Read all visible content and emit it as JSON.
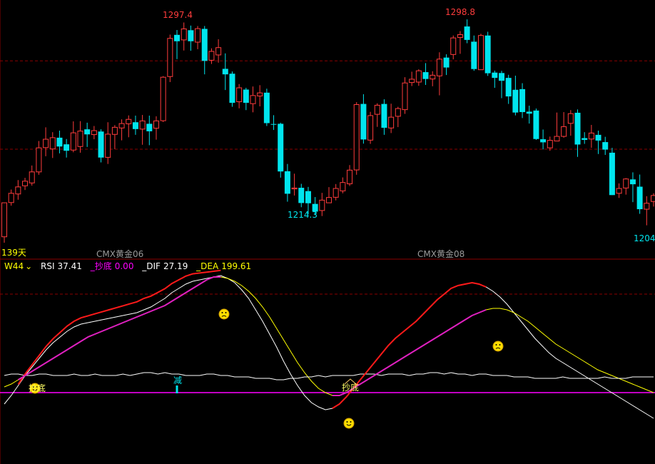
{
  "colors": {
    "up": "#ff3c3c",
    "down": "#00e5ee",
    "grid": "#8b0000",
    "label_yellow": "#ffff00",
    "rsi": "#ffffff",
    "dip": "#ff00ff",
    "dif": "#ffffff",
    "dea": "#ffff00",
    "macd_up": "#ff1a1a",
    "macd_mid": "#e020c0",
    "contract_label": "#9a9a9a"
  },
  "price_panel": {
    "high_label_1": "1297.4",
    "high_label_2": "1298.8",
    "low_label_1": "1214.3",
    "low_label_2": "1204.",
    "days_label": "139天",
    "contract_1": "CMX黄金06",
    "contract_2": "CMX黄金08"
  },
  "indicator_bar": {
    "period": "W44",
    "rsi_label": "RSI",
    "rsi_value": "37.41",
    "dip_label": "_抄底",
    "dip_value": "0.00",
    "dif_label": "_DIF",
    "dif_value": "27.19",
    "dea_label": "_DEA",
    "dea_value": "199.61"
  },
  "indicator_panel": {
    "marker_text_1": "抄底",
    "marker_text_2": "抄底",
    "marker_text_3": "减",
    "smiley_happy": "smiley-happy-icon",
    "smiley_sad": "smiley-sad-icon"
  },
  "chart_data": [
    {
      "type": "candlestick",
      "title": "",
      "y_range": [
        1196,
        1305
      ],
      "reference_lines": [
        1280,
        1240
      ],
      "candles": [
        [
          1200.3,
          1215.7,
          1197.6,
          1215.8
        ],
        [
          1215.8,
          1220.0,
          1214.4,
          1221.7
        ],
        [
          1219.7,
          1222.9,
          1217.1,
          1226.0
        ],
        [
          1223.4,
          1225.5,
          1221.5,
          1227.0
        ],
        [
          1224.7,
          1229.7,
          1223.5,
          1232.6
        ],
        [
          1229.7,
          1240.6,
          1228.4,
          1243.7
        ],
        [
          1240.7,
          1244.5,
          1236.8,
          1249.9
        ],
        [
          1240.1,
          1245.2,
          1236.0,
          1247.7
        ],
        [
          1245.2,
          1241.2,
          1238.1,
          1248.4
        ],
        [
          1242.2,
          1239.3,
          1236.2,
          1244.6
        ],
        [
          1239.6,
          1247.4,
          1238.6,
          1252.6
        ],
        [
          1241.2,
          1248.2,
          1238.4,
          1252.7
        ],
        [
          1249.0,
          1246.7,
          1241.0,
          1252.0
        ],
        [
          1246.6,
          1248.4,
          1244.5,
          1250.5
        ],
        [
          1248.0,
          1236.2,
          1234.0,
          1249.0
        ],
        [
          1236.3,
          1246.8,
          1233.3,
          1252.2
        ],
        [
          1246.7,
          1249.9,
          1240.0,
          1250.9
        ],
        [
          1249.6,
          1251.6,
          1244.0,
          1253.5
        ],
        [
          1251.5,
          1253.5,
          1245.4,
          1255.3
        ],
        [
          1252.2,
          1249.1,
          1246.5,
          1255.2
        ],
        [
          1249.1,
          1252.8,
          1242.0,
          1255.5
        ],
        [
          1251.5,
          1248.1,
          1241.8,
          1255.2
        ],
        [
          1249.5,
          1252.8,
          1244.3,
          1254.9
        ],
        [
          1252.9,
          1272.6,
          1252.3,
          1273.1
        ],
        [
          1272.9,
          1290.2,
          1270.4,
          1291.9
        ],
        [
          1291.8,
          1288.9,
          1280.8,
          1294.0
        ],
        [
          1289.5,
          1294.5,
          1284.7,
          1297.4
        ],
        [
          1293.9,
          1288.9,
          1284.6,
          1296.0
        ],
        [
          1288.5,
          1294.6,
          1285.3,
          1295.8
        ],
        [
          1294.5,
          1280.0,
          1273.9,
          1295.8
        ],
        [
          1280.3,
          1284.3,
          1278.6,
          1285.7
        ],
        [
          1282.7,
          1286.0,
          1279.2,
          1289.8
        ],
        [
          1276.4,
          1273.9,
          1266.8,
          1283.4
        ],
        [
          1274.2,
          1261.0,
          1259.2,
          1275.2
        ],
        [
          1261.5,
          1267.8,
          1258.5,
          1269.5
        ],
        [
          1267.0,
          1261.0,
          1257.7,
          1267.8
        ],
        [
          1260.6,
          1264.3,
          1256.7,
          1268.4
        ],
        [
          1264.1,
          1265.5,
          1259.4,
          1269.0
        ],
        [
          1265.6,
          1251.8,
          1250.5,
          1267.4
        ],
        [
          1251.4,
          1251.1,
          1248.7,
          1255.4
        ],
        [
          1251.5,
          1229.9,
          1227.1,
          1252.0
        ],
        [
          1230.0,
          1219.8,
          1216.2,
          1233.3
        ],
        [
          1222.0,
          1222.4,
          1219.0,
          1228.9
        ],
        [
          1222.5,
          1215.6,
          1213.7,
          1224.3
        ],
        [
          1221.0,
          1215.5,
          1210.4,
          1222.9
        ],
        [
          1215.2,
          1211.7,
          1210.1,
          1218.3
        ],
        [
          1212.2,
          1216.9,
          1209.7,
          1220.2
        ],
        [
          1215.7,
          1218.1,
          1215.6,
          1222.8
        ],
        [
          1218.2,
          1222.2,
          1216.8,
          1224.2
        ],
        [
          1221.1,
          1224.9,
          1220.0,
          1227.2
        ],
        [
          1224.3,
          1230.5,
          1223.3,
          1232.8
        ],
        [
          1230.6,
          1260.2,
          1228.4,
          1261.3
        ],
        [
          1260.5,
          1244.4,
          1242.5,
          1264.9
        ],
        [
          1244.1,
          1255.2,
          1242.4,
          1256.9
        ],
        [
          1255.8,
          1259.9,
          1250.1,
          1260.8
        ],
        [
          1260.5,
          1249.7,
          1246.5,
          1262.6
        ],
        [
          1249.6,
          1254.5,
          1247.3,
          1260.6
        ],
        [
          1254.9,
          1258.4,
          1250.0,
          1259.2
        ],
        [
          1257.9,
          1270.0,
          1256.0,
          1272.6
        ],
        [
          1270.2,
          1271.7,
          1268.6,
          1275.1
        ],
        [
          1270.4,
          1275.5,
          1268.7,
          1276.2
        ],
        [
          1274.9,
          1271.8,
          1269.1,
          1279.0
        ],
        [
          1271.8,
          1273.5,
          1268.5,
          1275.3
        ],
        [
          1273.2,
          1280.8,
          1264.4,
          1283.9
        ],
        [
          1281.5,
          1277.0,
          1273.6,
          1283.0
        ],
        [
          1282.9,
          1290.4,
          1280.7,
          1291.5
        ],
        [
          1290.6,
          1291.9,
          1283.2,
          1293.5
        ],
        [
          1295.6,
          1289.5,
          1288.0,
          1298.8
        ],
        [
          1288.7,
          1276.3,
          1275.5,
          1291.5
        ],
        [
          1276.0,
          1291.5,
          1275.9,
          1292.3
        ],
        [
          1291.5,
          1274.4,
          1273.2,
          1293.2
        ],
        [
          1274.7,
          1272.3,
          1267.8,
          1275.6
        ],
        [
          1274.5,
          1271.0,
          1263.1,
          1275.5
        ],
        [
          1272.3,
          1263.9,
          1260.5,
          1273.7
        ],
        [
          1266.9,
          1256.6,
          1255.3,
          1273.3
        ],
        [
          1267.2,
          1256.8,
          1254.1,
          1269.9
        ],
        [
          1257.0,
          1256.1,
          1251.6,
          1259.7
        ],
        [
          1257.5,
          1244.6,
          1244.2,
          1258.4
        ],
        [
          1244.5,
          1243.1,
          1239.9,
          1248.9
        ],
        [
          1240.6,
          1244.0,
          1239.3,
          1245.7
        ],
        [
          1243.7,
          1245.8,
          1244.0,
          1256.6
        ],
        [
          1245.8,
          1250.2,
          1245.2,
          1256.8
        ],
        [
          1251.7,
          1256.1,
          1246.1,
          1257.7
        ],
        [
          1256.5,
          1242.1,
          1236.5,
          1258.0
        ],
        [
          1245.0,
          1244.2,
          1242.4,
          1247.7
        ],
        [
          1244.6,
          1247.3,
          1240.6,
          1251.0
        ],
        [
          1246.5,
          1243.9,
          1237.8,
          1248.4
        ],
        [
          1243.2,
          1239.8,
          1237.4,
          1245.6
        ],
        [
          1238.4,
          1219.2,
          1219.2,
          1240.6
        ],
        [
          1220.0,
          1222.2,
          1217.9,
          1224.5
        ],
        [
          1222.4,
          1226.5,
          1219.4,
          1226.9
        ],
        [
          1226.3,
          1224.1,
          1216.0,
          1229.5
        ],
        [
          1223.0,
          1212.8,
          1210.7,
          1228.5
        ],
        [
          1212.8,
          1215.5,
          1205.5,
          1218.7
        ],
        [
          1216.3,
          1219.0,
          1214.0,
          1220.0
        ]
      ]
    },
    {
      "type": "line",
      "title": "",
      "y_range": [
        0,
        100
      ],
      "series": [
        {
          "name": "DIF",
          "line": [
            32,
            38,
            45,
            52,
            58,
            64,
            70,
            75,
            79,
            83,
            86,
            88,
            89,
            90,
            91,
            92,
            93,
            94,
            95,
            96,
            98,
            100,
            103,
            106,
            110,
            113,
            116,
            118,
            119,
            120,
            121,
            122,
            120,
            117,
            112,
            106,
            98,
            90,
            81,
            72,
            62,
            53,
            45,
            38,
            33,
            30,
            28,
            29,
            32,
            37,
            43,
            49,
            55,
            61,
            67,
            73,
            78,
            82,
            86,
            90,
            95,
            100,
            105,
            109,
            113,
            115,
            116,
            117,
            116,
            114,
            111,
            107,
            102,
            96,
            90,
            84,
            78,
            73,
            68,
            64,
            61,
            58,
            55,
            52,
            49,
            46,
            43,
            40,
            37,
            34,
            31,
            28,
            25,
            22
          ]
        },
        {
          "name": "DEA",
          "line": [
            44,
            46,
            49,
            52,
            55,
            58,
            61,
            64,
            67,
            70,
            73,
            76,
            79,
            81,
            83,
            85,
            87,
            89,
            91,
            93,
            95,
            97,
            99,
            101,
            104,
            107,
            110,
            113,
            116,
            119,
            121,
            121,
            120,
            118,
            115,
            111,
            106,
            100,
            93,
            85,
            77,
            69,
            61,
            54,
            48,
            43,
            40,
            38,
            38,
            40,
            43,
            46,
            49,
            52,
            55,
            58,
            61,
            64,
            67,
            70,
            73,
            76,
            79,
            82,
            85,
            88,
            91,
            94,
            96,
            98,
            99,
            99,
            98,
            96,
            93,
            90,
            86,
            82,
            78,
            74,
            71,
            68,
            65,
            62,
            59,
            56,
            54,
            52,
            50,
            48,
            46,
            44,
            42,
            40
          ]
        },
        {
          "name": "RSI",
          "line": [
            52,
            53,
            53,
            52,
            52,
            53,
            53,
            52,
            52,
            52,
            53,
            52,
            52,
            53,
            52,
            52,
            52,
            53,
            52,
            53,
            54,
            54,
            53,
            54,
            53,
            53,
            52,
            52,
            52,
            53,
            53,
            52,
            52,
            51,
            51,
            51,
            50,
            50,
            50,
            49,
            49,
            50,
            50,
            51,
            51,
            52,
            51,
            52,
            52,
            52,
            52,
            53,
            53,
            53,
            52,
            53,
            53,
            53,
            52,
            53,
            53,
            54,
            54,
            53,
            54,
            53,
            53,
            52,
            53,
            53,
            52,
            52,
            52,
            51,
            51,
            51,
            50,
            50,
            50,
            50,
            51,
            50,
            50,
            50,
            50,
            50,
            51,
            50,
            50,
            50,
            51,
            51,
            51,
            51
          ]
        }
      ]
    }
  ]
}
